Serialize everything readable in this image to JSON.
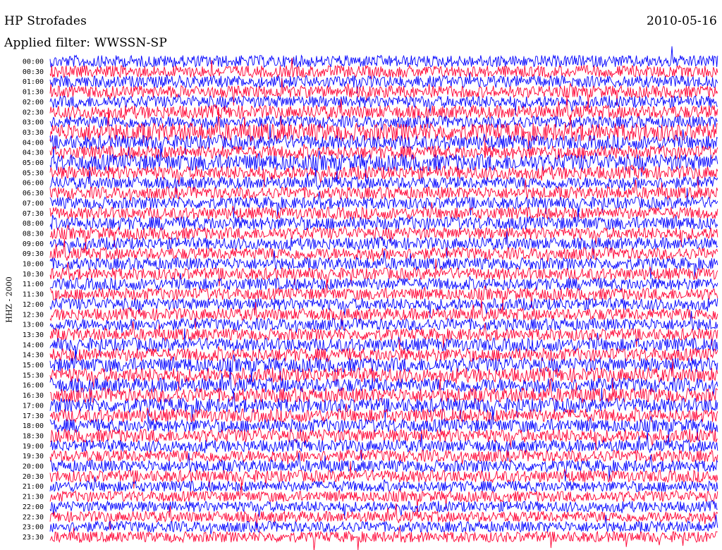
{
  "header": {
    "station": "HP Strofades",
    "date": "2010-05-16",
    "filter": "Applied filter: WWSSN-SP"
  },
  "chart_data": {
    "type": "line",
    "title": "HP Strofades",
    "subtitle": "Applied filter: WWSSN-SP",
    "ylabel": "HHZ - 2000",
    "xlabel": "",
    "grid": false,
    "legend": "none",
    "rows": [
      {
        "label": "00:00",
        "color": "#0000ff",
        "amp": 1.0
      },
      {
        "label": "00:30",
        "color": "#ff0033",
        "amp": 1.0
      },
      {
        "label": "01:00",
        "color": "#0000ff",
        "amp": 1.0
      },
      {
        "label": "01:30",
        "color": "#ff0033",
        "amp": 1.0
      },
      {
        "label": "02:00",
        "color": "#0000ff",
        "amp": 1.0
      },
      {
        "label": "02:30",
        "color": "#ff0033",
        "amp": 1.1
      },
      {
        "label": "03:00",
        "color": "#0000ff",
        "amp": 1.0
      },
      {
        "label": "03:30",
        "color": "#ff0033",
        "amp": 1.5
      },
      {
        "label": "04:00",
        "color": "#0000ff",
        "amp": 1.2
      },
      {
        "label": "04:30",
        "color": "#ff0033",
        "amp": 1.1
      },
      {
        "label": "05:00",
        "color": "#0000ff",
        "amp": 1.4
      },
      {
        "label": "05:30",
        "color": "#ff0033",
        "amp": 1.1
      },
      {
        "label": "06:00",
        "color": "#0000ff",
        "amp": 1.0
      },
      {
        "label": "06:30",
        "color": "#ff0033",
        "amp": 1.0
      },
      {
        "label": "07:00",
        "color": "#0000ff",
        "amp": 1.0
      },
      {
        "label": "07:30",
        "color": "#ff0033",
        "amp": 1.0
      },
      {
        "label": "08:00",
        "color": "#0000ff",
        "amp": 1.1
      },
      {
        "label": "08:30",
        "color": "#ff0033",
        "amp": 1.0
      },
      {
        "label": "09:00",
        "color": "#0000ff",
        "amp": 1.0
      },
      {
        "label": "09:30",
        "color": "#ff0033",
        "amp": 1.0
      },
      {
        "label": "10:00",
        "color": "#0000ff",
        "amp": 1.0
      },
      {
        "label": "10:30",
        "color": "#ff0033",
        "amp": 1.0
      },
      {
        "label": "11:00",
        "color": "#0000ff",
        "amp": 1.0
      },
      {
        "label": "11:30",
        "color": "#ff0033",
        "amp": 1.0
      },
      {
        "label": "12:00",
        "color": "#0000ff",
        "amp": 1.0
      },
      {
        "label": "12:30",
        "color": "#ff0033",
        "amp": 1.0
      },
      {
        "label": "13:00",
        "color": "#0000ff",
        "amp": 1.0
      },
      {
        "label": "13:30",
        "color": "#ff0033",
        "amp": 1.0
      },
      {
        "label": "14:00",
        "color": "#0000ff",
        "amp": 1.1
      },
      {
        "label": "14:30",
        "color": "#ff0033",
        "amp": 1.1
      },
      {
        "label": "15:00",
        "color": "#0000ff",
        "amp": 1.2
      },
      {
        "label": "15:30",
        "color": "#ff0033",
        "amp": 1.2
      },
      {
        "label": "16:00",
        "color": "#0000ff",
        "amp": 1.2
      },
      {
        "label": "16:30",
        "color": "#ff0033",
        "amp": 1.2
      },
      {
        "label": "17:00",
        "color": "#0000ff",
        "amp": 1.2
      },
      {
        "label": "17:30",
        "color": "#ff0033",
        "amp": 1.1
      },
      {
        "label": "18:00",
        "color": "#0000ff",
        "amp": 1.1
      },
      {
        "label": "18:30",
        "color": "#ff0033",
        "amp": 1.1
      },
      {
        "label": "19:00",
        "color": "#0000ff",
        "amp": 1.0
      },
      {
        "label": "19:30",
        "color": "#ff0033",
        "amp": 1.0
      },
      {
        "label": "20:00",
        "color": "#0000ff",
        "amp": 1.0
      },
      {
        "label": "20:30",
        "color": "#ff0033",
        "amp": 1.0
      },
      {
        "label": "21:00",
        "color": "#0000ff",
        "amp": 0.9
      },
      {
        "label": "21:30",
        "color": "#ff0033",
        "amp": 0.9
      },
      {
        "label": "22:00",
        "color": "#0000ff",
        "amp": 0.9
      },
      {
        "label": "22:30",
        "color": "#ff0033",
        "amp": 0.9
      },
      {
        "label": "23:00",
        "color": "#0000ff",
        "amp": 0.9
      },
      {
        "label": "23:30",
        "color": "#ff0033",
        "amp": 0.9
      }
    ]
  }
}
